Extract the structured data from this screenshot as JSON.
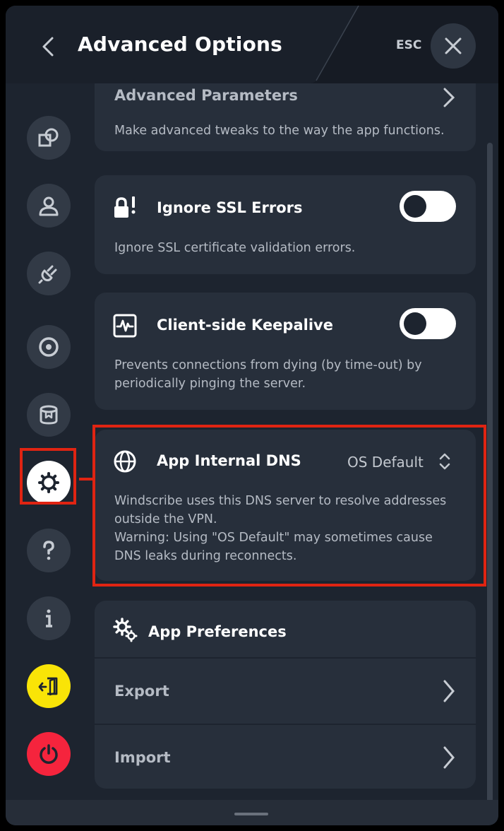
{
  "header": {
    "title": "Advanced Options",
    "esc_label": "ESC"
  },
  "sidebar": {
    "items": [
      {
        "name": "connection",
        "icon": "shapes-icon"
      },
      {
        "name": "account",
        "icon": "user-icon"
      },
      {
        "name": "connection-plug",
        "icon": "plug-icon"
      },
      {
        "name": "robert",
        "icon": "ring-icon"
      },
      {
        "name": "storage",
        "icon": "cylinder-icon"
      },
      {
        "name": "advanced",
        "icon": "gear-icon",
        "active": true
      },
      {
        "name": "help",
        "icon": "question-icon"
      },
      {
        "name": "about",
        "icon": "info-icon"
      },
      {
        "name": "logout",
        "icon": "exit-icon",
        "color": "#f9e407"
      },
      {
        "name": "quit",
        "icon": "power-icon",
        "color": "#f5243d"
      }
    ]
  },
  "cards": {
    "advanced_parameters": {
      "title": "Advanced Parameters",
      "description": "Make advanced tweaks to the way the app functions."
    },
    "ignore_ssl": {
      "title": "Ignore SSL Errors",
      "description": "Ignore SSL certificate validation errors.",
      "enabled": false
    },
    "keepalive": {
      "title": "Client-side Keepalive",
      "description_line1": "Prevents connections from dying (by time-out) by",
      "description_line2": "periodically pinging the server.",
      "enabled": false
    },
    "dns": {
      "title": "App Internal DNS",
      "value": "OS Default",
      "line1": "Windscribe uses this DNS server to resolve addresses",
      "line2": "outside the VPN.",
      "line3": "Warning: Using \"OS Default\" may sometimes cause",
      "line4": "DNS leaks during reconnects."
    },
    "preferences": {
      "title": "App Preferences",
      "export_label": "Export",
      "import_label": "Import"
    }
  },
  "colors": {
    "background": "#1d242f",
    "card": "#272f3b",
    "highlight": "#e02412"
  }
}
